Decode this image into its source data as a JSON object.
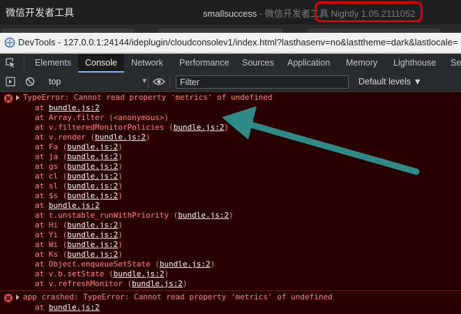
{
  "titlebar": {
    "app_name": "微信开发者工具",
    "window_title": "smallsuccess",
    "window_subtitle": " - 微信开发者工具 Nightly 1.05.2111052"
  },
  "urlbar": {
    "url": "DevTools - 127.0.0.1:24144/ideplugin/cloudconsolev1/index.html?lasthasenv=no&lasttheme=dark&lastlocale="
  },
  "tabs": [
    "Elements",
    "Console",
    "Network",
    "Performance",
    "Sources",
    "Application",
    "Memory",
    "Lighthouse",
    "Se"
  ],
  "active_tab": "Console",
  "toolbar": {
    "context": "top",
    "filter_placeholder": "Filter",
    "levels": "Default levels ▼"
  },
  "console": {
    "error1": {
      "message": "TypeError: Cannot read property 'metrics' of undefined",
      "stack": [
        {
          "pre": "at ",
          "link": "bundle.js:2",
          "post": ""
        },
        {
          "pre": "at Array.filter (<anonymous>)",
          "link": "",
          "post": ""
        },
        {
          "pre": "at v.filteredMonitorPolicies (",
          "link": "bundle.js:2",
          "post": ")"
        },
        {
          "pre": "at v.render (",
          "link": "bundle.js:2",
          "post": ")"
        },
        {
          "pre": "at Fa (",
          "link": "bundle.js:2",
          "post": ")"
        },
        {
          "pre": "at ja (",
          "link": "bundle.js:2",
          "post": ")"
        },
        {
          "pre": "at gs (",
          "link": "bundle.js:2",
          "post": ")"
        },
        {
          "pre": "at cl (",
          "link": "bundle.js:2",
          "post": ")"
        },
        {
          "pre": "at sl (",
          "link": "bundle.js:2",
          "post": ")"
        },
        {
          "pre": "at $s (",
          "link": "bundle.js:2",
          "post": ")"
        },
        {
          "pre": "at ",
          "link": "bundle.js:2",
          "post": ""
        },
        {
          "pre": "at t.unstable_runWithPriority (",
          "link": "bundle.js:2",
          "post": ")"
        },
        {
          "pre": "at Hi (",
          "link": "bundle.js:2",
          "post": ")"
        },
        {
          "pre": "at Yi (",
          "link": "bundle.js:2",
          "post": ")"
        },
        {
          "pre": "at Wi (",
          "link": "bundle.js:2",
          "post": ")"
        },
        {
          "pre": "at Ks (",
          "link": "bundle.js:2",
          "post": ")"
        },
        {
          "pre": "at Object.enqueueSetState (",
          "link": "bundle.js:2",
          "post": ")"
        },
        {
          "pre": "at v.b.setState (",
          "link": "bundle.js:2",
          "post": ")"
        },
        {
          "pre": "at v.refreshMonitor (",
          "link": "bundle.js:2",
          "post": ")"
        }
      ]
    },
    "error2": {
      "message": "app crashed: TypeError: Cannot read property 'metrics' of undefined",
      "stack": [
        {
          "pre": "at ",
          "link": "bundle.js:2",
          "post": ""
        }
      ]
    }
  },
  "colors": {
    "console_bg": "#290000",
    "error_text": "#ff8080",
    "link_text": "#ffffff",
    "annotation_arrow": "#2f8a87",
    "annotation_oval": "#e00000",
    "active_tab_underline": "#8ab4f8"
  },
  "icons": [
    "devtools-icon",
    "inspect-element-icon",
    "device-toolbar-icon",
    "play-icon",
    "clear-console-icon",
    "eye-icon",
    "error-icon",
    "expand-triangle-icon"
  ]
}
